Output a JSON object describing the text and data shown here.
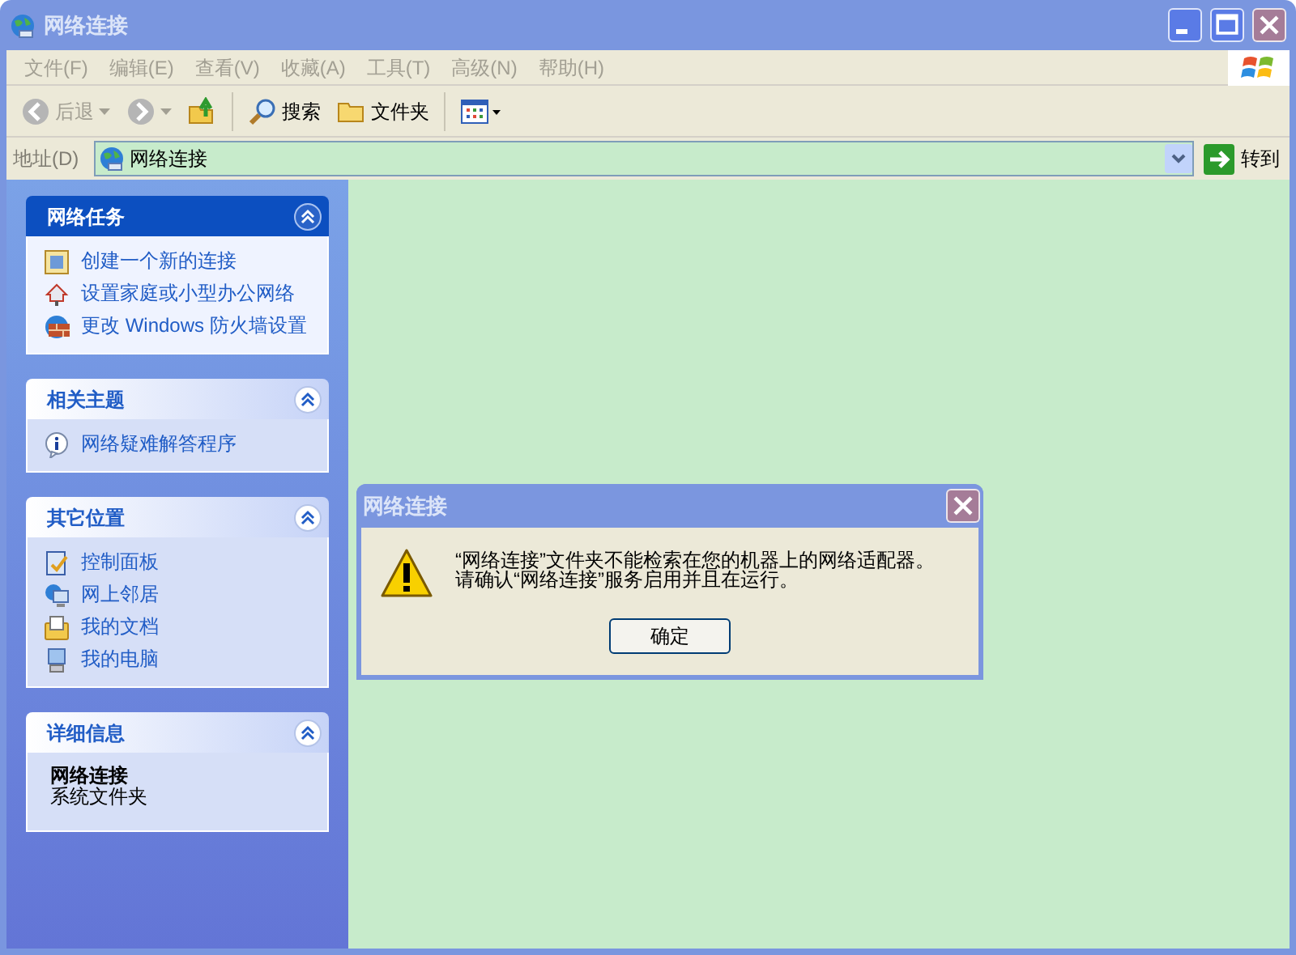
{
  "window": {
    "title": "网络连接",
    "active": false
  },
  "menu": [
    "文件(F)",
    "编辑(E)",
    "查看(V)",
    "收藏(A)",
    "工具(T)",
    "高级(N)",
    "帮助(H)"
  ],
  "toolbar": [
    {
      "kind": "back",
      "label": "后退",
      "disabled": true
    },
    {
      "kind": "forward",
      "disabled": true
    },
    {
      "kind": "up"
    },
    {
      "kind": "search",
      "label": "搜索"
    },
    {
      "kind": "folders",
      "label": "文件夹"
    },
    {
      "kind": "views"
    }
  ],
  "address": {
    "label": "地址(D)",
    "value": "网络连接",
    "go": "转到"
  },
  "sidebar": [
    {
      "kind": "primary",
      "title": "网络任务",
      "items": [
        {
          "label": "创建一个新的连接"
        },
        {
          "label": "设置家庭或小型办公网络"
        },
        {
          "label": "更改 Windows 防火墙设置"
        }
      ]
    },
    {
      "kind": "normal",
      "title": "相关主题",
      "items": [
        {
          "label": "网络疑难解答程序"
        }
      ]
    },
    {
      "kind": "normal",
      "title": "其它位置",
      "items": [
        {
          "label": "控制面板"
        },
        {
          "label": "网上邻居"
        },
        {
          "label": "我的文档"
        },
        {
          "label": "我的电脑"
        }
      ]
    },
    {
      "kind": "details",
      "title": "详细信息",
      "name": "网络连接",
      "type": "系统文件夹"
    }
  ],
  "dialog": {
    "title": "网络连接",
    "lines": [
      "“网络连接”文件夹不能检索在您的机器上的网络适配器。",
      "请确认“网络连接”服务启用并且在运行。"
    ],
    "button": "确定"
  }
}
